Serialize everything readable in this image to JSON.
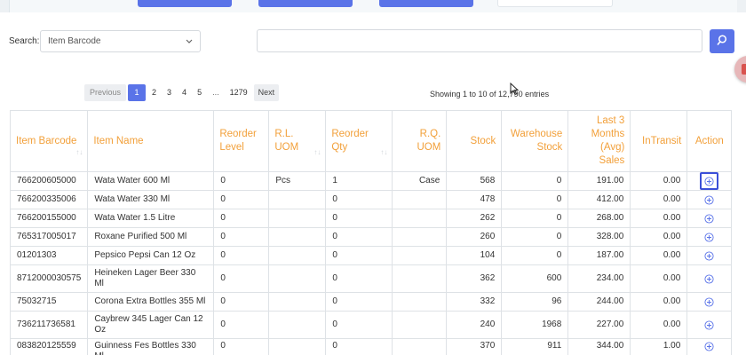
{
  "search": {
    "label": "Search:",
    "selected_field": "Item Barcode",
    "query": ""
  },
  "pagination": {
    "previous_label": "Previous",
    "pages": [
      "1",
      "2",
      "3",
      "4",
      "5",
      "...",
      "1279"
    ],
    "active_page": "1",
    "next_label": "Next"
  },
  "entries_info": "Showing 1 to 10 of 12,790 entries",
  "table": {
    "columns": [
      "Item Barcode",
      "Item Name",
      "Reorder Level",
      "R.L. UOM",
      "Reorder Qty",
      "R.Q. UOM",
      "Stock",
      "Warehouse Stock",
      "Last 3 Months (Avg) Sales",
      "InTransit",
      "Action"
    ],
    "rows": [
      {
        "barcode": "766200605000",
        "name": "Wata Water 600 Ml",
        "reorder_level": "0",
        "rl_uom": "Pcs",
        "reorder_qty": "1",
        "rq_uom": "Case",
        "stock": "568",
        "warehouse_stock": "0",
        "avg_sales": "191.00",
        "in_transit": "0.00"
      },
      {
        "barcode": "766200335006",
        "name": "Wata Water 330 Ml",
        "reorder_level": "0",
        "rl_uom": "",
        "reorder_qty": "0",
        "rq_uom": "",
        "stock": "478",
        "warehouse_stock": "0",
        "avg_sales": "412.00",
        "in_transit": "0.00"
      },
      {
        "barcode": "766200155000",
        "name": "Wata Water 1.5 Litre",
        "reorder_level": "0",
        "rl_uom": "",
        "reorder_qty": "0",
        "rq_uom": "",
        "stock": "262",
        "warehouse_stock": "0",
        "avg_sales": "268.00",
        "in_transit": "0.00"
      },
      {
        "barcode": "765317005017",
        "name": "Roxane Purified 500 Ml",
        "reorder_level": "0",
        "rl_uom": "",
        "reorder_qty": "0",
        "rq_uom": "",
        "stock": "260",
        "warehouse_stock": "0",
        "avg_sales": "328.00",
        "in_transit": "0.00"
      },
      {
        "barcode": "01201303",
        "name": "Pepsico Pepsi Can 12 Oz",
        "reorder_level": "0",
        "rl_uom": "",
        "reorder_qty": "0",
        "rq_uom": "",
        "stock": "104",
        "warehouse_stock": "0",
        "avg_sales": "187.00",
        "in_transit": "0.00"
      },
      {
        "barcode": "8712000030575",
        "name": "Heineken Lager Beer 330 Ml",
        "reorder_level": "0",
        "rl_uom": "",
        "reorder_qty": "0",
        "rq_uom": "",
        "stock": "362",
        "warehouse_stock": "600",
        "avg_sales": "234.00",
        "in_transit": "0.00"
      },
      {
        "barcode": "75032715",
        "name": "Corona Extra Bottles 355 Ml",
        "reorder_level": "0",
        "rl_uom": "",
        "reorder_qty": "0",
        "rq_uom": "",
        "stock": "332",
        "warehouse_stock": "96",
        "avg_sales": "244.00",
        "in_transit": "0.00"
      },
      {
        "barcode": "736211736581",
        "name": "Caybrew 345 Lager Can 12 Oz",
        "reorder_level": "0",
        "rl_uom": "",
        "reorder_qty": "0",
        "rq_uom": "",
        "stock": "240",
        "warehouse_stock": "1968",
        "avg_sales": "227.00",
        "in_transit": "0.00"
      },
      {
        "barcode": "083820125559",
        "name": "Guinness Fes Bottles 330 Ml",
        "reorder_level": "0",
        "rl_uom": "",
        "reorder_qty": "0",
        "rq_uom": "",
        "stock": "370",
        "warehouse_stock": "911",
        "avg_sales": "344.00",
        "in_transit": "1.00"
      }
    ]
  },
  "colors": {
    "accent": "#5a73e8",
    "header_text": "#f2a03a",
    "focus_outline": "#3b4fd8"
  },
  "icons": {
    "search_button": "search-icon",
    "row_action": "plus-circle-icon"
  }
}
